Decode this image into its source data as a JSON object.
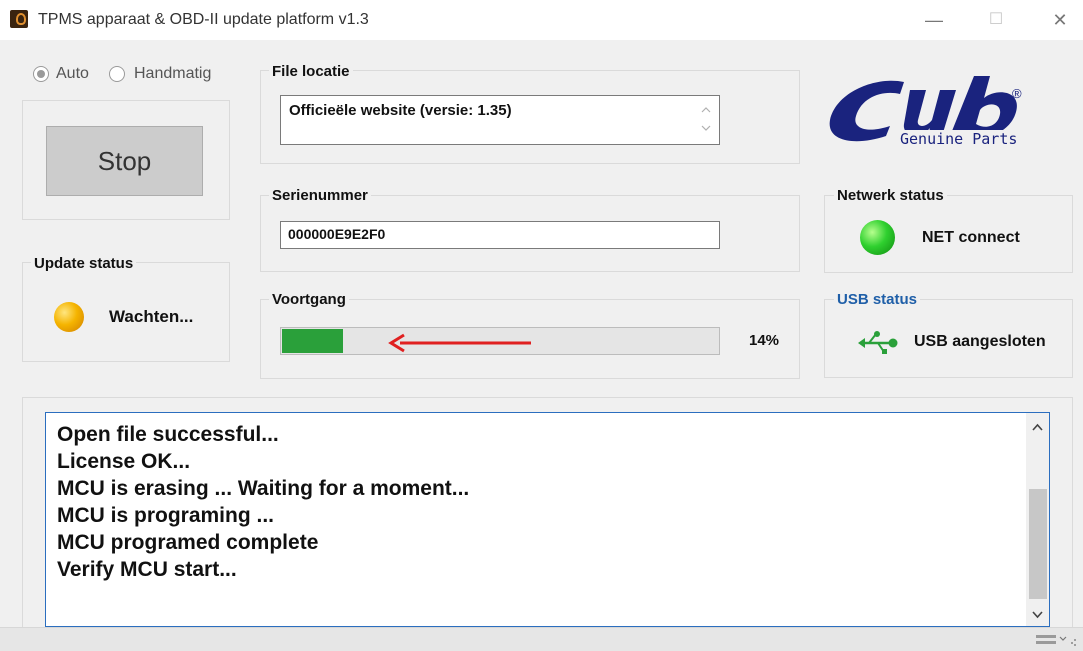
{
  "window": {
    "title": "TPMS apparaat & OBD-II update platform v1.3",
    "controls": {
      "minimize": "—",
      "maximize": "☐",
      "close": "✕"
    }
  },
  "mode": {
    "options": [
      "Auto",
      "Handmatig"
    ],
    "selected": "Auto"
  },
  "stop_button": {
    "label": "Stop"
  },
  "file_location": {
    "label": "File locatie",
    "value": "Officieële website (versie: 1.35)"
  },
  "serial": {
    "label": "Serienummer",
    "value": "000000E9E2F0"
  },
  "progress": {
    "label": "Voortgang",
    "percent_text": "14%",
    "value": 0.14,
    "fill_color": "#2aa03a"
  },
  "update_status": {
    "label": "Update status",
    "text": "Wachten...",
    "led_color": "orange"
  },
  "network_status": {
    "label": "Netwerk status",
    "text": "NET connect",
    "led_color": "green"
  },
  "usb_status": {
    "label": "USB status",
    "text": "USB aangesloten",
    "icon": "usb-icon",
    "label_color": "#1f5fa8"
  },
  "logo": {
    "brand": "Cub",
    "sub": "Genuine Parts",
    "mark": "®",
    "color": "#1a237e"
  },
  "log": {
    "lines": [
      "Open  file successful...",
      "License OK...",
      "MCU is erasing ... Waiting for a moment...",
      "MCU is programing ...",
      "MCU programed complete",
      "Verify MCU start..."
    ]
  },
  "annotation": {
    "icon": "red-arrow-icon",
    "color": "#e02020"
  }
}
